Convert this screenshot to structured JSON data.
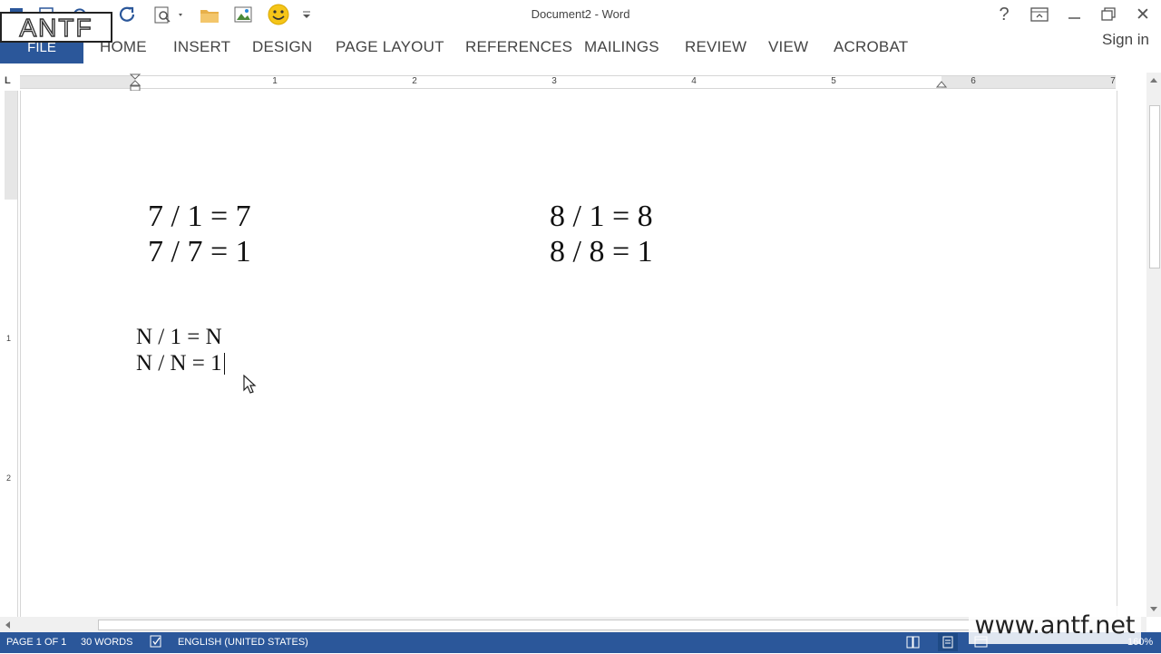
{
  "window": {
    "title": "Document2 - Word",
    "sign_in": "Sign in",
    "help": "?",
    "close": "✕"
  },
  "ribbon": {
    "tabs": [
      "FILE",
      "HOME",
      "INSERT",
      "DESIGN",
      "PAGE LAYOUT",
      "REFERENCES",
      "MAILINGS",
      "REVIEW",
      "VIEW",
      "ACROBAT"
    ]
  },
  "ruler": {
    "corner": "L",
    "numbers": [
      "1",
      "2",
      "3",
      "4",
      "5",
      "6",
      "7"
    ],
    "vertical_numbers": [
      "1",
      "2"
    ]
  },
  "document": {
    "left_block": [
      "7 / 1 = 7",
      "7 / 7 = 1"
    ],
    "right_block": [
      "8 / 1 = 8",
      "8 / 8 = 1"
    ],
    "general_block": [
      "N / 1 = N",
      "N / N = 1"
    ]
  },
  "status_bar": {
    "page": "PAGE 1 OF 1",
    "words": "30 WORDS",
    "language": "ENGLISH (UNITED STATES)",
    "zoom": "160%"
  },
  "watermarks": {
    "logo": "ANTF",
    "site": "www.antf.net"
  },
  "colors": {
    "accent": "#2b579a",
    "redo": "#2b579a",
    "folder": "#e8b04a",
    "smiley": "#f5c518"
  },
  "icons": [
    "word-icon",
    "save-icon",
    "undo-icon",
    "redo-icon",
    "print-preview-icon",
    "open-folder-icon",
    "insert-picture-icon",
    "smiley-icon",
    "customize-qat-icon",
    "help-icon",
    "ribbon-display-icon",
    "minimize-icon",
    "restore-icon",
    "close-icon",
    "proofing-icon",
    "read-mode-icon",
    "print-layout-icon",
    "web-layout-icon",
    "mouse-pointer-icon"
  ]
}
